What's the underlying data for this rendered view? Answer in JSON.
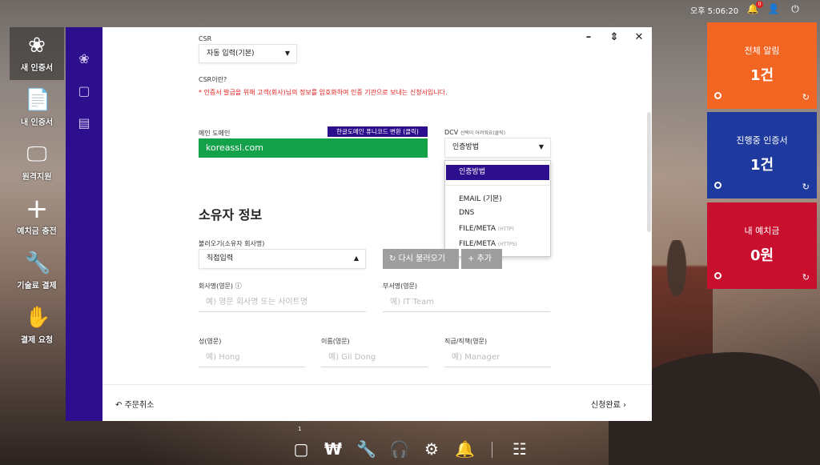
{
  "topbar": {
    "clock": "오후 5:06:20",
    "notification_count": "0"
  },
  "dock": [
    {
      "label": "새 인증서",
      "icon": "ribbon-icon"
    },
    {
      "label": "내 인증서",
      "icon": "certificate-icon"
    },
    {
      "label": "원격지원",
      "icon": "monitor-icon"
    },
    {
      "label": "예치금 충전",
      "icon": "plus-icon"
    },
    {
      "label": "기술료 결제",
      "icon": "wrench-icon"
    },
    {
      "label": "결제 요청",
      "icon": "payment-hand-icon"
    }
  ],
  "form": {
    "csr_label": "CSR",
    "csr_select": "자동 입력(기본)",
    "csr_question": "CSR이란?",
    "csr_note": "* 인증서 발급을 위해 고객(회사)님의 정보를 암호화하여 인증 기관으로 보내는 신청서입니다.",
    "main_domain_label": "메인 도메인",
    "convert_button": "한글도메인 퓨니코드 변환 (클릭)",
    "main_domain_value": "koreassl.com",
    "dcv_label": "DCV",
    "dcv_hint": "선택이 어려워요(클릭)",
    "dcv_select": "인증방법",
    "dcv_options": [
      {
        "label": "인증방법",
        "sub": ""
      },
      {
        "label": "EMAIL (기본)",
        "sub": ""
      },
      {
        "label": "DNS",
        "sub": ""
      },
      {
        "label": "FILE/META",
        "sub": "(HTTP)"
      },
      {
        "label": "FILE/META",
        "sub": "(HTTPS)"
      }
    ],
    "owner_title": "소유자 정보",
    "load_label": "불러오기(소유자 회사명)",
    "load_select": "직접입력",
    "reload_button": "다시 불러오기",
    "add_button": "추가",
    "company_label": "회사명(영문)",
    "company_placeholder": "예) 영문 회사명 또는 사이트명",
    "dept_label": "부서명(영문)",
    "dept_placeholder": "예) IT Team",
    "last_name_label": "성(영문)",
    "last_name_placeholder": "예) Hong",
    "first_name_label": "이름(영문)",
    "first_name_placeholder": "예) Gil Dong",
    "position_label": "직급/직책(영문)",
    "position_placeholder": "예) Manager"
  },
  "footer": {
    "cancel": "주문취소",
    "complete": "신청완료"
  },
  "tiles": [
    {
      "title": "전체 알림",
      "value": "1건",
      "color": "#f26522"
    },
    {
      "title": "진행중 인증서",
      "value": "1건",
      "color": "#1e3a9e"
    },
    {
      "title": "내 예치금",
      "value": "0원",
      "color": "#c8102e"
    }
  ],
  "bottom_dock": {
    "badge": "1"
  }
}
